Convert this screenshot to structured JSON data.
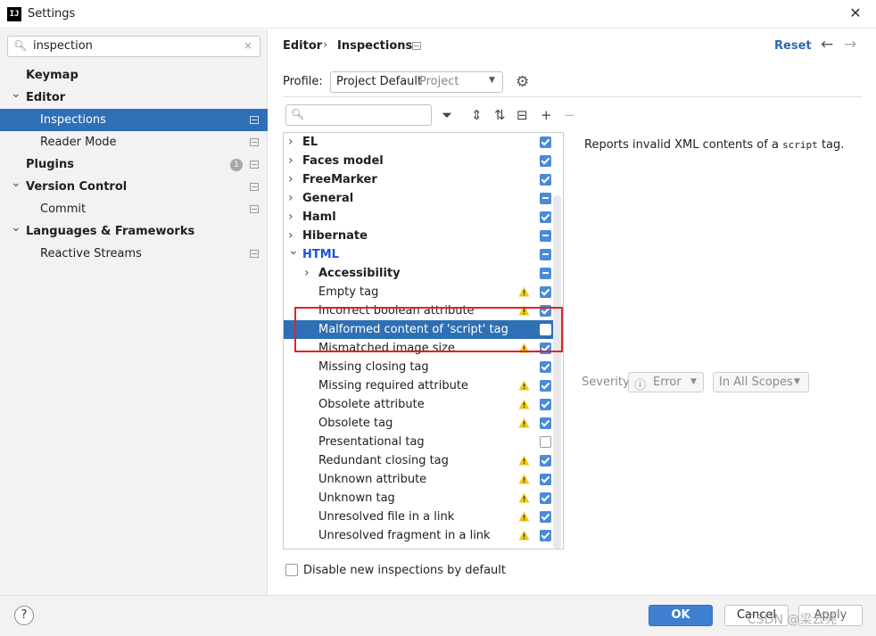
{
  "window": {
    "title": "Settings",
    "app_icon": "IJ",
    "close_glyph": "✕"
  },
  "sidebar": {
    "search": {
      "value": "inspection",
      "icon": "🔍︎",
      "clear": "×"
    },
    "items": [
      {
        "label": "Keymap"
      },
      {
        "label": "Editor",
        "expanded": true
      },
      {
        "label": "Inspections",
        "selected": true
      },
      {
        "label": "Reader Mode"
      },
      {
        "label": "Plugins",
        "badge": "1"
      },
      {
        "label": "Version Control",
        "expanded": true
      },
      {
        "label": "Commit"
      },
      {
        "label": "Languages & Frameworks",
        "expanded": true
      },
      {
        "label": "Reactive Streams"
      }
    ]
  },
  "header": {
    "breadcrumb_parent": "Editor",
    "breadcrumb_sep": "›",
    "breadcrumb_current": "Inspections",
    "reset_label": "Reset",
    "back": "←",
    "forward": "→"
  },
  "profile": {
    "label": "Profile:",
    "value": "Project Default",
    "scope": "Project",
    "caret": "▼",
    "gear": "⚙"
  },
  "toolbar": {
    "filter_icon": "🔍︎",
    "funnel": "⏷",
    "expand_all": "⇕",
    "collapse_all": "⇅",
    "toggle": "⊟",
    "add": "+",
    "remove": "−"
  },
  "tree": {
    "rows": [
      {
        "label": "EL",
        "bold": true,
        "group": true,
        "state": "on"
      },
      {
        "label": "Faces model",
        "bold": true,
        "group": true,
        "state": "on"
      },
      {
        "label": "FreeMarker",
        "bold": true,
        "group": true,
        "state": "on"
      },
      {
        "label": "General",
        "bold": true,
        "group": true,
        "state": "ind"
      },
      {
        "label": "Haml",
        "bold": true,
        "group": true,
        "state": "on"
      },
      {
        "label": "Hibernate",
        "bold": true,
        "group": true,
        "state": "ind"
      },
      {
        "label": "HTML",
        "bold": true,
        "group": true,
        "open": true,
        "state": "ind",
        "highlight": true
      },
      {
        "label": "Accessibility",
        "bold": true,
        "group": true,
        "child": true,
        "state": "ind"
      },
      {
        "label": "Empty tag",
        "warn": true,
        "state": "on"
      },
      {
        "label": "Incorrect boolean attribute",
        "warn": true,
        "state": "on"
      },
      {
        "label": "Malformed content of 'script' tag",
        "state": "off",
        "selected": true
      },
      {
        "label": "Mismatched image size",
        "warn": true,
        "state": "on"
      },
      {
        "label": "Missing closing tag",
        "state": "on"
      },
      {
        "label": "Missing required attribute",
        "warn": true,
        "state": "on"
      },
      {
        "label": "Obsolete attribute",
        "warn": true,
        "state": "on"
      },
      {
        "label": "Obsolete tag",
        "warn": true,
        "state": "on"
      },
      {
        "label": "Presentational tag",
        "state": "off"
      },
      {
        "label": "Redundant closing tag",
        "warn": true,
        "state": "on"
      },
      {
        "label": "Unknown attribute",
        "warn": true,
        "state": "on"
      },
      {
        "label": "Unknown tag",
        "warn": true,
        "state": "on"
      },
      {
        "label": "Unresolved file in a link",
        "warn": true,
        "state": "on"
      },
      {
        "label": "Unresolved fragment in a link",
        "warn": true,
        "state": "on"
      }
    ]
  },
  "description": {
    "prefix": "Reports invalid XML contents of a ",
    "code": "script",
    "suffix": " tag."
  },
  "severity": {
    "label": "Severity:",
    "value": "Error",
    "scope": "In All Scopes",
    "caret": "▼",
    "icon": "ⓘ"
  },
  "disable_new": {
    "label": "Disable new inspections by default",
    "checked": false
  },
  "footer": {
    "help": "?",
    "ok": "OK",
    "cancel": "Cancel",
    "apply": "Apply"
  },
  "watermark": "CSDN @梁云亮",
  "colors": {
    "accent": "#2f6fb5",
    "checkbox": "#4a8ad8",
    "link": "#2a6bb3",
    "highlight_box": "#e02424",
    "warning": "#f2c811"
  }
}
